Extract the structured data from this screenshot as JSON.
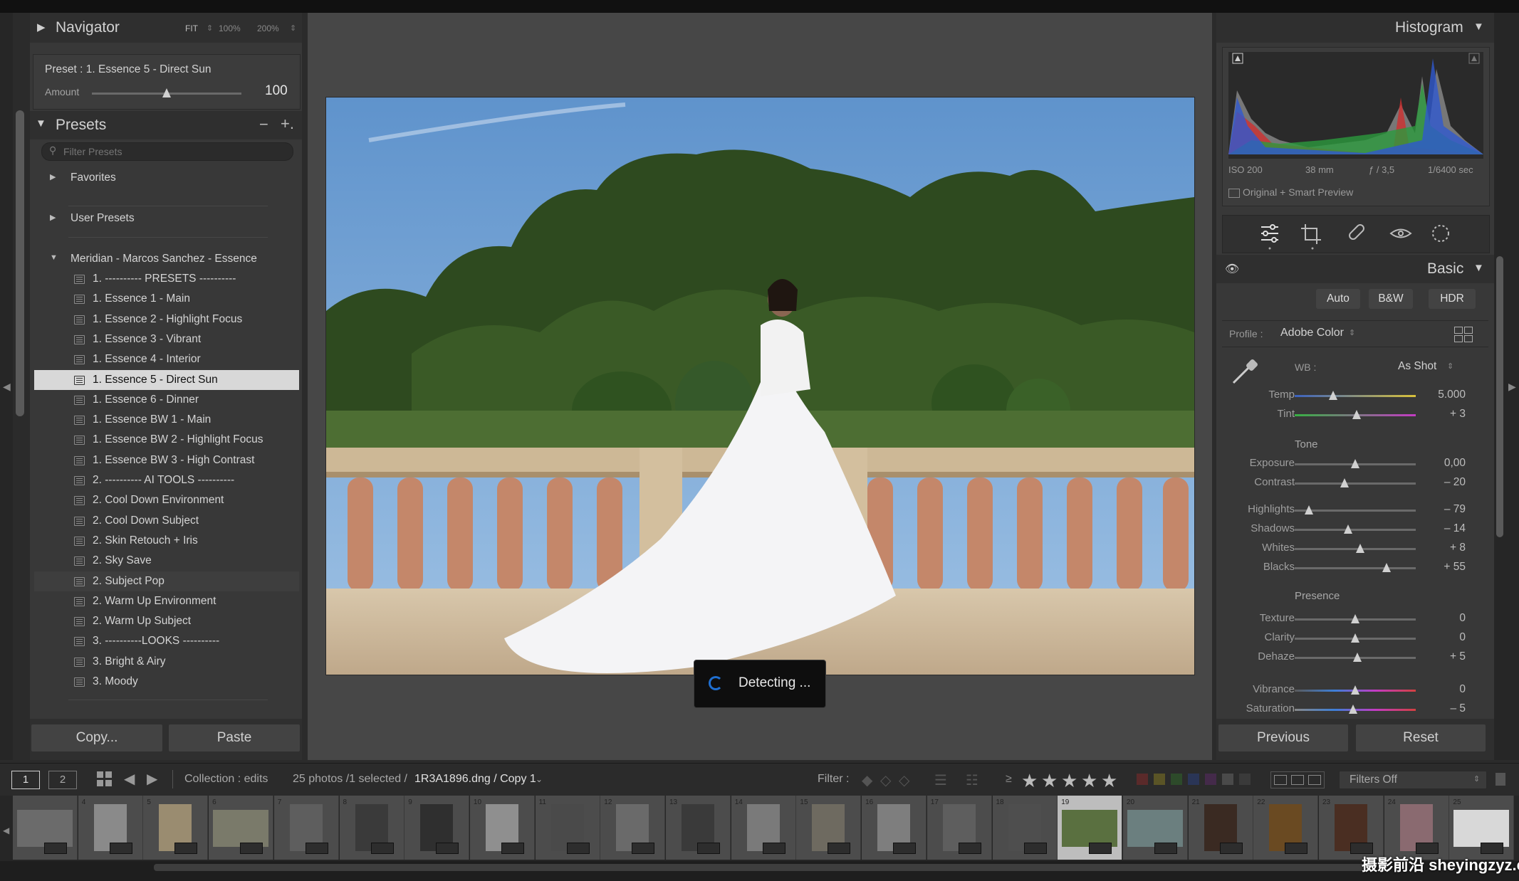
{
  "navigator": {
    "title": "Navigator",
    "zoom_fit": "FIT",
    "zoom_100": "100%",
    "zoom_200": "200%",
    "preset_line": "Preset : 1. Essence 5 - Direct Sun",
    "amount_label": "Amount",
    "amount_value": "100",
    "amount_level": 0.5
  },
  "presets": {
    "title": "Presets",
    "minus": "−",
    "plus": "+.",
    "filter_placeholder": "Filter Presets",
    "groups": [
      {
        "label": "Favorites"
      },
      {
        "label": "User Presets"
      },
      {
        "label": "Meridian - Marcos Sanchez - Essence"
      }
    ],
    "items": [
      "1. ---------- PRESETS ----------",
      "1. Essence 1 - Main",
      "1. Essence 2 - Highlight Focus",
      "1. Essence 3 - Vibrant",
      "1. Essence 4 - Interior",
      "1. Essence 5 - Direct Sun",
      "1. Essence 6 - Dinner",
      "1. Essence BW 1 - Main",
      "1. Essence BW 2 - Highlight Focus",
      "1. Essence BW 3 - High Contrast",
      "2. ---------- AI TOOLS ----------",
      "2. Cool Down Environment",
      "2. Cool Down Subject",
      "2. Skin Retouch + Iris",
      "2. Sky Save",
      "2. Subject Pop",
      "2. Warm Up Environment",
      "2. Warm Up Subject",
      "3. ----------LOOKS ----------",
      "3. Bright & Airy",
      "3. Moody"
    ],
    "selected_index": 5
  },
  "left_buttons": {
    "copy": "Copy...",
    "paste": "Paste"
  },
  "detecting": "Detecting ...",
  "histogram": {
    "title": "Histogram",
    "iso": "ISO 200",
    "focal": "38 mm",
    "aperture": "ƒ / 3,5",
    "shutter": "1/6400 sec",
    "preview": "Original + Smart Preview"
  },
  "basic": {
    "title": "Basic",
    "auto": "Auto",
    "bw": "B&W",
    "hdr": "HDR",
    "profile_label": "Profile :",
    "profile_value": "Adobe Color",
    "wb_label": "WB :",
    "wb_value": "As Shot",
    "tone_label": "Tone",
    "presence_label": "Presence",
    "sliders": [
      {
        "label": "Temp",
        "value": "5.000",
        "level": 0.32
      },
      {
        "label": "Tint",
        "value": "+ 3",
        "level": 0.51
      },
      {
        "label": "Exposure",
        "value": "0,00",
        "level": 0.5
      },
      {
        "label": "Contrast",
        "value": "– 20",
        "level": 0.41
      },
      {
        "label": "Highlights",
        "value": "– 79",
        "level": 0.12
      },
      {
        "label": "Shadows",
        "value": "– 14",
        "level": 0.44
      },
      {
        "label": "Whites",
        "value": "+ 8",
        "level": 0.54
      },
      {
        "label": "Blacks",
        "value": "+ 55",
        "level": 0.76
      },
      {
        "label": "Texture",
        "value": "0",
        "level": 0.5
      },
      {
        "label": "Clarity",
        "value": "0",
        "level": 0.5
      },
      {
        "label": "Dehaze",
        "value": "+ 5",
        "level": 0.52
      },
      {
        "label": "Vibrance",
        "value": "0",
        "level": 0.5
      },
      {
        "label": "Saturation",
        "value": "– 5",
        "level": 0.48
      }
    ],
    "previous": "Previous",
    "reset": "Reset"
  },
  "toolbar": {
    "screen1": "1",
    "screen2": "2",
    "collection": "Collection : edits",
    "count": "25 photos /1 selected /",
    "filename": "1R3A1896.dng / Copy 1",
    "filter_label": "Filter :",
    "filters_off": "Filters Off"
  },
  "filmstrip": {
    "numbers": [
      "",
      "4",
      "5",
      "6",
      "7",
      "8",
      "9",
      "10",
      "11",
      "12",
      "13",
      "14",
      "15",
      "16",
      "17",
      "18",
      "19",
      "20",
      "21",
      "22",
      "23",
      "24",
      "25"
    ],
    "selected_index": 16
  },
  "watermark": "摄影前沿 sheyingzyz.com",
  "colors": {
    "bg": "#2b2b2b",
    "panel": "#383838",
    "accent_selected": "#d8d8d8",
    "sky": "#6f9fd1",
    "foliage": "#2f4a22",
    "stone": "#c9b79a"
  }
}
